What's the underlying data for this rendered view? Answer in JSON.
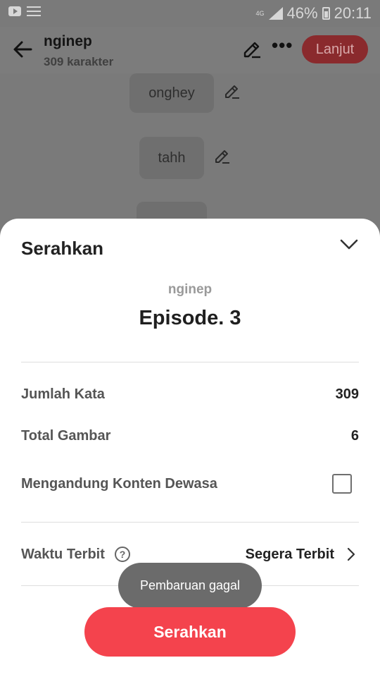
{
  "status_bar": {
    "network": "4G",
    "battery": "46%",
    "time": "20:11"
  },
  "header": {
    "title": "nginep",
    "subtitle": "309 karakter",
    "next_label": "Lanjut"
  },
  "background_items": [
    {
      "label": "onghey"
    },
    {
      "label": "tahh"
    },
    {
      "label": ""
    }
  ],
  "sheet": {
    "title": "Serahkan",
    "story_name": "nginep",
    "episode": "Episode. 3",
    "rows": {
      "word_count_label": "Jumlah Kata",
      "word_count_value": "309",
      "image_total_label": "Total Gambar",
      "image_total_value": "6",
      "adult_label": "Mengandung Konten Dewasa",
      "adult_checked": false,
      "publish_label": "Waktu Terbit",
      "publish_value": "Segera Terbit"
    },
    "help_symbol": "?",
    "submit_label": "Serahkan"
  },
  "toast": {
    "message": "Pembaruan gagal"
  },
  "colors": {
    "accent": "#f4434d",
    "accent_dimmed": "#8a2a2d"
  }
}
